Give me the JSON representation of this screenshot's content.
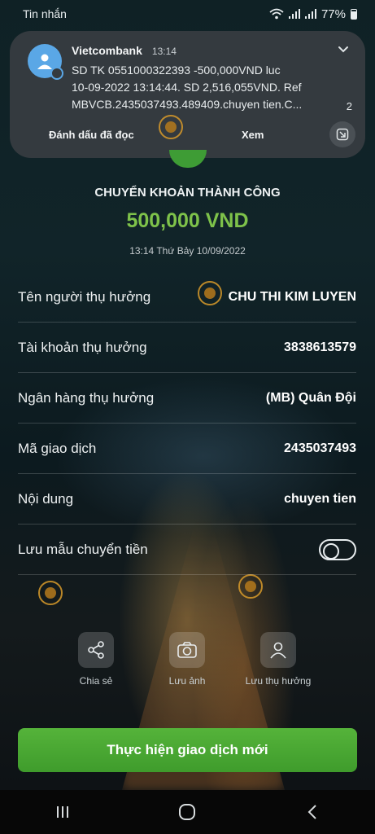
{
  "status_bar": {
    "label": "Tin nhắn",
    "battery": "77%"
  },
  "notification": {
    "sender": "Vietcombank",
    "time": "13:14",
    "lines": [
      "SD TK 0551000322393 -500,000VND luc",
      "10-09-2022 13:14:44. SD 2,516,055VND. Ref",
      "MBVCB.2435037493.489409.chuyen tien.C..."
    ],
    "count": "2",
    "action_mark_read": "Đánh dấu đã đọc",
    "action_view": "Xem"
  },
  "result": {
    "title": "CHUYỂN KHOẢN THÀNH CÔNG",
    "amount": "500,000 VND",
    "datetime": "13:14 Thứ Bảy 10/09/2022"
  },
  "details": {
    "beneficiary_label": "Tên người thụ hưởng",
    "beneficiary_value": "CHU THI KIM LUYEN",
    "account_label": "Tài khoản thụ hưởng",
    "account_value": "3838613579",
    "bank_label": "Ngân hàng thụ hưởng",
    "bank_value": "(MB) Quân Đội",
    "transaction_label": "Mã giao dịch",
    "transaction_value": "2435037493",
    "content_label": "Nội dung",
    "content_value": "chuyen tien",
    "save_template_label": "Lưu mẫu chuyển tiền",
    "save_template_on": false
  },
  "actions": {
    "share": "Chia sẻ",
    "save_image": "Lưu ảnh",
    "save_beneficiary": "Lưu thụ hưởng"
  },
  "primary_button": "Thực hiện giao dịch mới",
  "colors": {
    "accent_green": "#7ec24a",
    "button_green": "#4aa833",
    "notification_bg": "#343a3f"
  }
}
